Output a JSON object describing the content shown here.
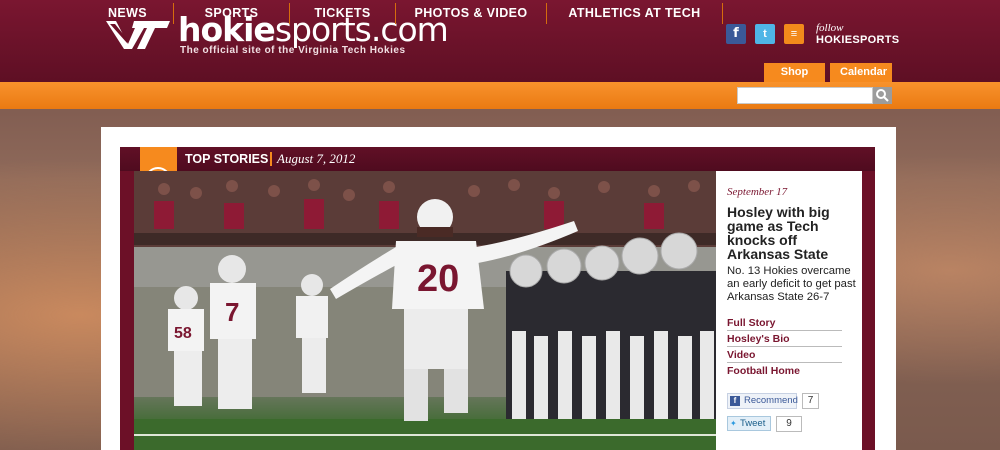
{
  "header": {
    "logo_mark": "VT",
    "site_title_bold": "hokie",
    "site_title_rest": "sports.com",
    "tagline": "The official site of the Virginia Tech Hokies",
    "social_icons": [
      "facebook-icon",
      "twitter-icon",
      "rss-icon"
    ],
    "social_glyphs": {
      "facebook": "f",
      "twitter": "t",
      "rss": "≡"
    },
    "follow_line1": "follow",
    "follow_line2": "HOKIESPORTS",
    "utility_links": [
      "Shop",
      "Calendar"
    ]
  },
  "nav": {
    "items": [
      "NEWS",
      "SPORTS",
      "TICKETS",
      "PHOTOS & VIDEO",
      "ATHLETICS AT TECH"
    ],
    "search_placeholder": ""
  },
  "top_stories": {
    "label": "TOP STORIES",
    "date": "August 7, 2012"
  },
  "story": {
    "date": "September 17",
    "headline": "Hosley with big game as Tech knocks off Arkansas State",
    "summary": "No. 13 Hokies overcame an early deficit to get past Arkansas State 26-7",
    "links": [
      "Full Story",
      "Hosley's Bio",
      "Video",
      "Football Home"
    ],
    "share": {
      "recommend_label": "Recommend",
      "recommend_count": "7",
      "tweet_label": "Tweet",
      "tweet_count": "9"
    },
    "jersey_numbers": [
      "20",
      "7",
      "58"
    ]
  },
  "colors": {
    "maroon": "#6c1027",
    "orange": "#f68a1e",
    "white": "#ffffff"
  }
}
